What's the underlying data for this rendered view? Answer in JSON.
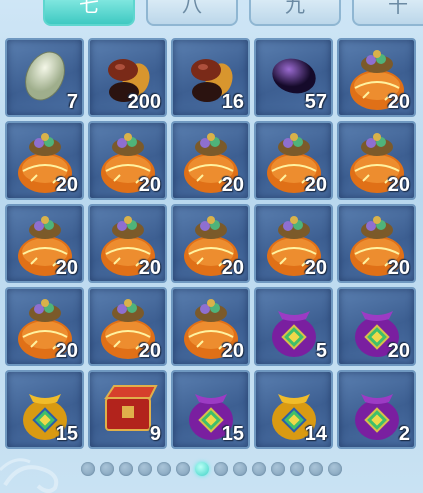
{
  "tabs": [
    {
      "label": "七",
      "active": true
    },
    {
      "label": "八",
      "active": false
    },
    {
      "label": "九",
      "active": false
    },
    {
      "label": "十",
      "active": false
    }
  ],
  "slots": [
    {
      "item": "white-stone",
      "count": "7"
    },
    {
      "item": "brown-bean-pile",
      "count": "200"
    },
    {
      "item": "brown-bean-pile",
      "count": "16"
    },
    {
      "item": "purple-stone",
      "count": "57"
    },
    {
      "item": "orange-gift-bag",
      "count": "20"
    },
    {
      "item": "orange-gift-bag",
      "count": "20"
    },
    {
      "item": "orange-gift-bag",
      "count": "20"
    },
    {
      "item": "orange-gift-bag",
      "count": "20"
    },
    {
      "item": "orange-gift-bag",
      "count": "20"
    },
    {
      "item": "orange-gift-bag",
      "count": "20"
    },
    {
      "item": "orange-gift-bag",
      "count": "20"
    },
    {
      "item": "orange-gift-bag",
      "count": "20"
    },
    {
      "item": "orange-gift-bag",
      "count": "20"
    },
    {
      "item": "orange-gift-bag",
      "count": "20"
    },
    {
      "item": "orange-gift-bag",
      "count": "20"
    },
    {
      "item": "orange-gift-bag",
      "count": "20"
    },
    {
      "item": "orange-gift-bag",
      "count": "20"
    },
    {
      "item": "orange-gift-bag",
      "count": "20"
    },
    {
      "item": "purple-pouch",
      "count": "5"
    },
    {
      "item": "purple-pouch",
      "count": "20"
    },
    {
      "item": "gold-pouch",
      "count": "15"
    },
    {
      "item": "red-chest",
      "count": "9"
    },
    {
      "item": "purple-pouch",
      "count": "15"
    },
    {
      "item": "gold-pouch",
      "count": "14"
    },
    {
      "item": "purple-pouch",
      "count": "2"
    }
  ],
  "pagination": {
    "total": 14,
    "active_index": 6
  }
}
